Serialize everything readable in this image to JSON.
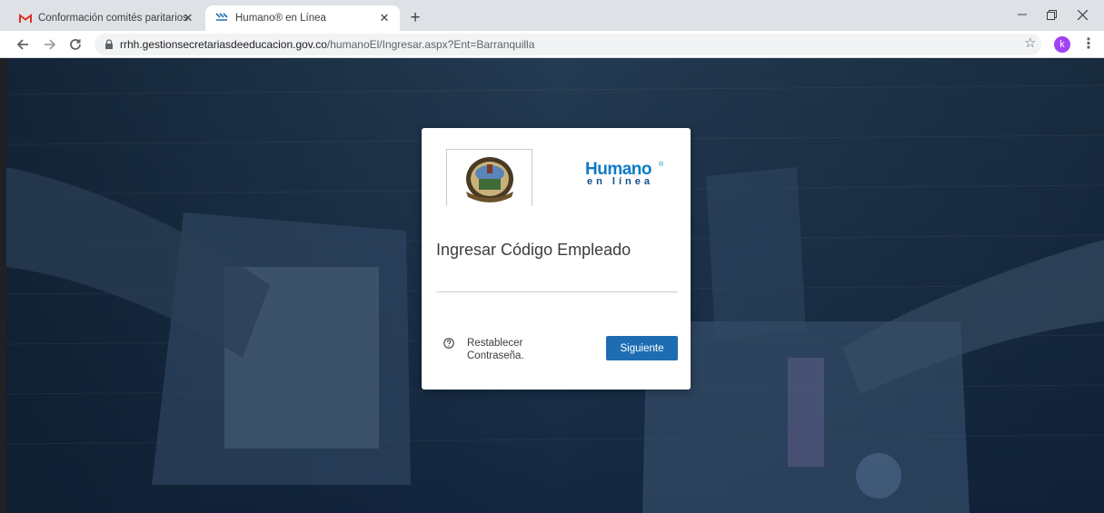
{
  "browser": {
    "tabs": [
      {
        "title": "Conformación comités paritarios"
      },
      {
        "title": "Humano® en Línea"
      }
    ],
    "close_symbol": "✕",
    "new_tab_symbol": "+",
    "address": {
      "host": "rrhh.gestionsecretariasdeeducacion.gov.co",
      "path": "/humanoEl/Ingresar.aspx?Ent=Barranquilla"
    },
    "profile_initial": "k",
    "icons": [
      "gmail-icon",
      "humano-favicon",
      "close-icon",
      "new-tab-icon",
      "minimize-icon",
      "restore-icon",
      "window-close-icon",
      "back-icon",
      "forward-icon",
      "reload-icon",
      "lock-icon",
      "star-icon",
      "menu-icon"
    ]
  },
  "login": {
    "brand_main": "Humano",
    "brand_sub": "en línea",
    "heading": "Ingresar Código Empleado",
    "input_value": "",
    "reset_link": "Restablecer Contraseña.",
    "next_button": "Siguiente",
    "accent_color": "#1e6db3"
  }
}
